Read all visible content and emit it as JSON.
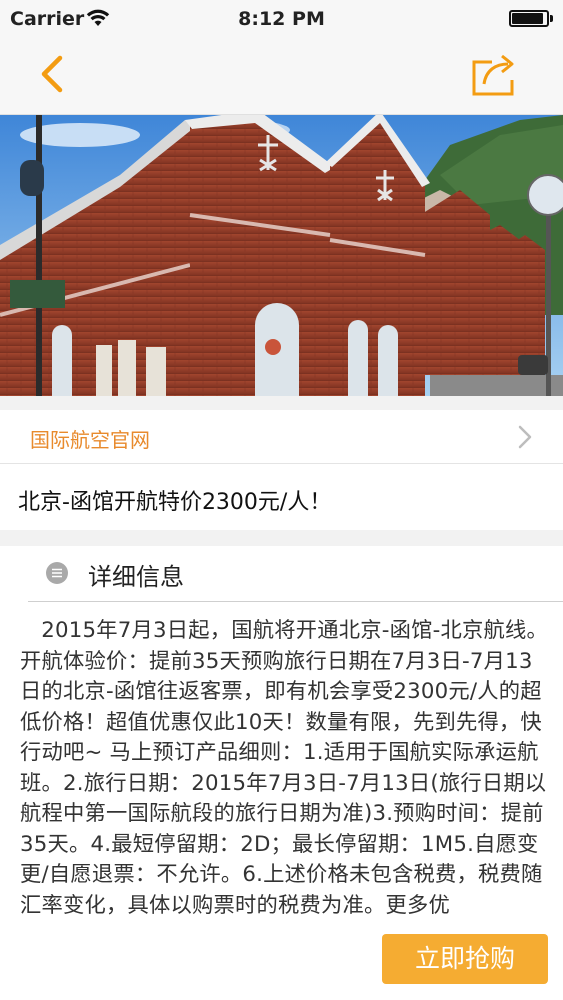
{
  "status_bar": {
    "carrier": "Carrier",
    "time": "8:12 PM",
    "battery_level": 0.9
  },
  "nav": {
    "back_icon": "chevron-left-icon",
    "share_icon": "share-icon",
    "accent_color": "#f39c12"
  },
  "hero": {
    "image": "red-brick-warehouses-photo"
  },
  "airline": {
    "label": "国际航空官网"
  },
  "deal": {
    "title": "北京-函馆开航特价2300元/人！"
  },
  "detail": {
    "header": "详细信息",
    "body": "2015年7月3日起，国航将开通北京-函馆-北京航线。开航体验价：提前35天预购旅行日期在7月3日-7月13日的北京-函馆往返客票，即有机会享受2300元/人的超低价格！超值优惠仅此10天！数量有限，先到先得，快行动吧~ 马上预订产品细则：1.适用于国航实际承运航班。2.旅行日期：2015年7月3日-7月13日(旅行日期以航程中第一国际航段的旅行日期为准)3.预购时间：提前35天。4.最短停留期：2D；最长停留期：1M5.自愿变更/自愿退票：不允许。6.上述价格未包含税费，税费随汇率变化，具体以购票时的税费为准。更多优"
  },
  "buy_button": {
    "label": "立即抢购"
  }
}
